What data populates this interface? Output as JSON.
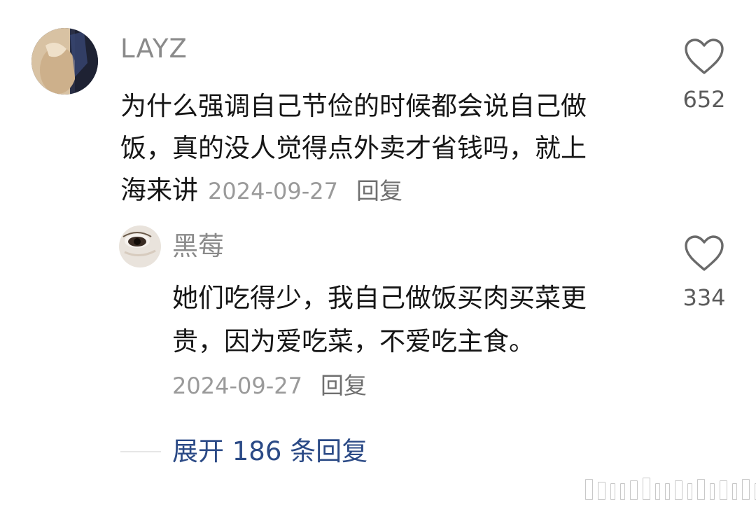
{
  "comment": {
    "username": "LAYZ",
    "text_lines": [
      "为什么强调自己节俭的时候都会说自己做",
      "饭，真的没人觉得点外卖才省钱吗，就上",
      "海来讲"
    ],
    "date": "2024-09-27",
    "reply_label": "回复",
    "like_count": "652",
    "icons": {
      "like": "heart-outline-icon",
      "avatar": "user-avatar"
    }
  },
  "reply": {
    "username": "黑莓",
    "text_lines": [
      "她们吃得少，我自己做饭买肉买菜更",
      "贵，因为爱吃菜，不爱吃主食。"
    ],
    "date": "2024-09-27",
    "reply_label": "回复",
    "like_count": "334",
    "icons": {
      "like": "heart-outline-icon",
      "avatar": "user-avatar"
    }
  },
  "expand_replies": {
    "label": "展开 186 条回复"
  },
  "colors": {
    "username": "#8a8a8a",
    "text": "#161616",
    "meta": "#9a9a9a",
    "expand_link": "#2b4a86"
  }
}
